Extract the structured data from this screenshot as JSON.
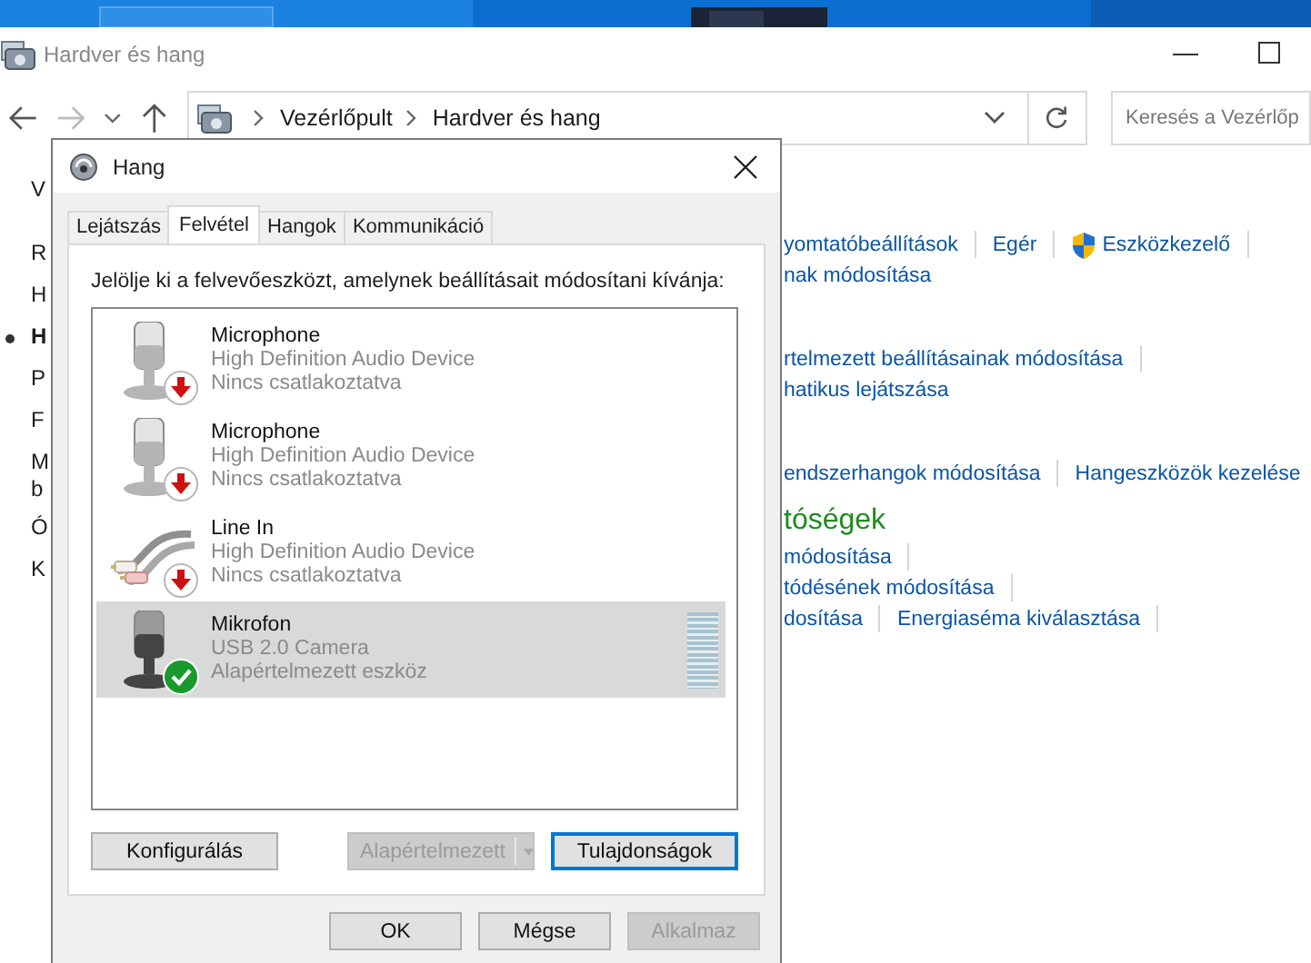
{
  "window": {
    "title": "Hardver és hang"
  },
  "address_bar": {
    "crumbs": [
      "Vezérlőpult",
      "Hardver és hang"
    ]
  },
  "search": {
    "placeholder": "Keresés a Vezérlőp"
  },
  "sidebar": {
    "items": [
      {
        "lines": [
          "V"
        ],
        "selected": false
      },
      {
        "lines": [
          "R"
        ],
        "selected": false
      },
      {
        "lines": [
          "H"
        ],
        "selected": false
      },
      {
        "lines": [
          "H"
        ],
        "selected": true
      },
      {
        "lines": [
          "P"
        ],
        "selected": false
      },
      {
        "lines": [
          "F"
        ],
        "selected": false
      },
      {
        "lines": [
          "M",
          "b"
        ],
        "selected": false
      },
      {
        "lines": [
          "Ó"
        ],
        "selected": false
      },
      {
        "lines": [
          "K"
        ],
        "selected": false
      }
    ]
  },
  "sections": [
    {
      "rows": [
        {
          "links": [
            {
              "text": "yomtatóbeállítások",
              "kind": "plain"
            },
            {
              "text": "Egér",
              "kind": "plain"
            },
            {
              "text": "Eszközkezelő",
              "kind": "shield"
            }
          ],
          "end_separator": true
        },
        {
          "links": [
            {
              "text": "nak módosítása",
              "kind": "plain"
            }
          ],
          "end_separator": false
        }
      ]
    },
    {
      "rows": [
        {
          "links": [
            {
              "text": "rtelmezett beállításainak módosítása",
              "kind": "plain"
            }
          ],
          "end_separator": true
        },
        {
          "links": [
            {
              "text": "hatikus lejátszása",
              "kind": "plain"
            }
          ],
          "end_separator": false
        }
      ]
    },
    {
      "rows": [
        {
          "links": [
            {
              "text": "endszerhangok módosítása",
              "kind": "plain"
            },
            {
              "text": "Hangeszközök kezelése",
              "kind": "plain"
            }
          ],
          "end_separator": false
        }
      ]
    },
    {
      "heading": "tóségek",
      "rows": [
        {
          "links": [
            {
              "text": "módosítása",
              "kind": "plain"
            }
          ],
          "end_separator": true
        },
        {
          "links": [
            {
              "text": "tódésének módosítása",
              "kind": "plain"
            }
          ],
          "end_separator": true
        },
        {
          "links": [
            {
              "text": "dosítása",
              "kind": "plain"
            },
            {
              "text": "Energiaséma kiválasztása",
              "kind": "plain"
            }
          ],
          "end_separator": true
        }
      ]
    }
  ],
  "dialog": {
    "title": "Hang",
    "tabs": [
      {
        "label": "Lejátszás",
        "selected": false
      },
      {
        "label": "Felvétel",
        "selected": true
      },
      {
        "label": "Hangok",
        "selected": false
      },
      {
        "label": "Kommunikáció",
        "selected": false
      }
    ],
    "instruction": "Jelölje ki a felvevőeszközt, amelynek beállításait módosítani kívánja:",
    "devices": [
      {
        "name": "Microphone",
        "description": "High Definition Audio Device",
        "status": "Nincs csatlakoztatva",
        "kind": "microphone",
        "default": false,
        "selected": false
      },
      {
        "name": "Microphone",
        "description": "High Definition Audio Device",
        "status": "Nincs csatlakoztatva",
        "kind": "microphone",
        "default": false,
        "selected": false
      },
      {
        "name": "Line In",
        "description": "High Definition Audio Device",
        "status": "Nincs csatlakoztatva",
        "kind": "line",
        "default": false,
        "selected": false
      },
      {
        "name": "Mikrofon",
        "description": "USB 2.0 Camera",
        "status": "Alapértelmezett eszköz",
        "kind": "microphone",
        "default": true,
        "selected": true,
        "level": 0
      }
    ],
    "panel_buttons": [
      {
        "label": "Konfigurálás",
        "disabled": false,
        "focused": false,
        "split": false
      },
      {
        "label": "Alapértelmezett",
        "disabled": true,
        "focused": false,
        "split": true
      },
      {
        "label": "Tulajdonságok",
        "disabled": false,
        "focused": true,
        "split": false
      }
    ],
    "buttons": [
      {
        "label": "OK",
        "disabled": false
      },
      {
        "label": "Mégse",
        "disabled": false
      },
      {
        "label": "Alkalmaz",
        "disabled": true
      }
    ]
  }
}
